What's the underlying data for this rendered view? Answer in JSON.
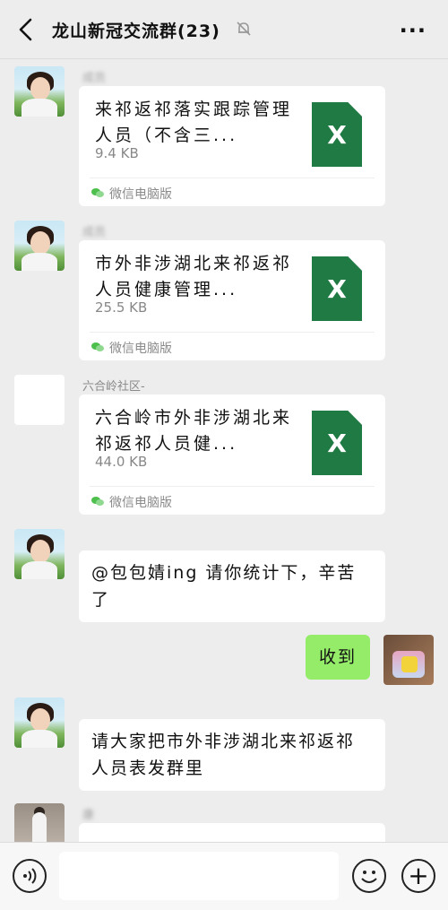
{
  "header": {
    "title": "龙山新冠交流群(23)",
    "back_icon": "chevron-left-icon",
    "mute_icon": "bell-off-icon",
    "more_label": "···"
  },
  "messages": [
    {
      "type": "file",
      "sender": "成员",
      "title": "来祁返祁落实跟踪管理人员（不含三...",
      "size": "9.4 KB",
      "source": "微信电脑版"
    },
    {
      "type": "file",
      "sender": "成员",
      "title": "市外非涉湖北来祁返祁人员健康管理...",
      "size": "25.5 KB",
      "source": "微信电脑版"
    },
    {
      "type": "file",
      "sender": "六合岭社区-",
      "title": "六合岭市外非涉湖北来祁返祁人员健...",
      "size": "44.0 KB",
      "source": "微信电脑版"
    },
    {
      "type": "text",
      "text": "@包包婧ing 请你统计下，辛苦了"
    },
    {
      "type": "text",
      "mine": true,
      "text": "收到"
    },
    {
      "type": "text",
      "text": "请大家把市外非涉湖北来祁返祁人员表发群里"
    },
    {
      "type": "text",
      "sender": "康",
      "text": ""
    }
  ],
  "file_icon_label": "X",
  "bottom": {
    "voice_icon": "voice-icon",
    "emoji_icon": "emoji-icon",
    "plus_label": "+",
    "input_value": ""
  },
  "colors": {
    "background": "#ededed",
    "bubble_mine": "#95ec69",
    "excel_green": "#1f7a44"
  }
}
